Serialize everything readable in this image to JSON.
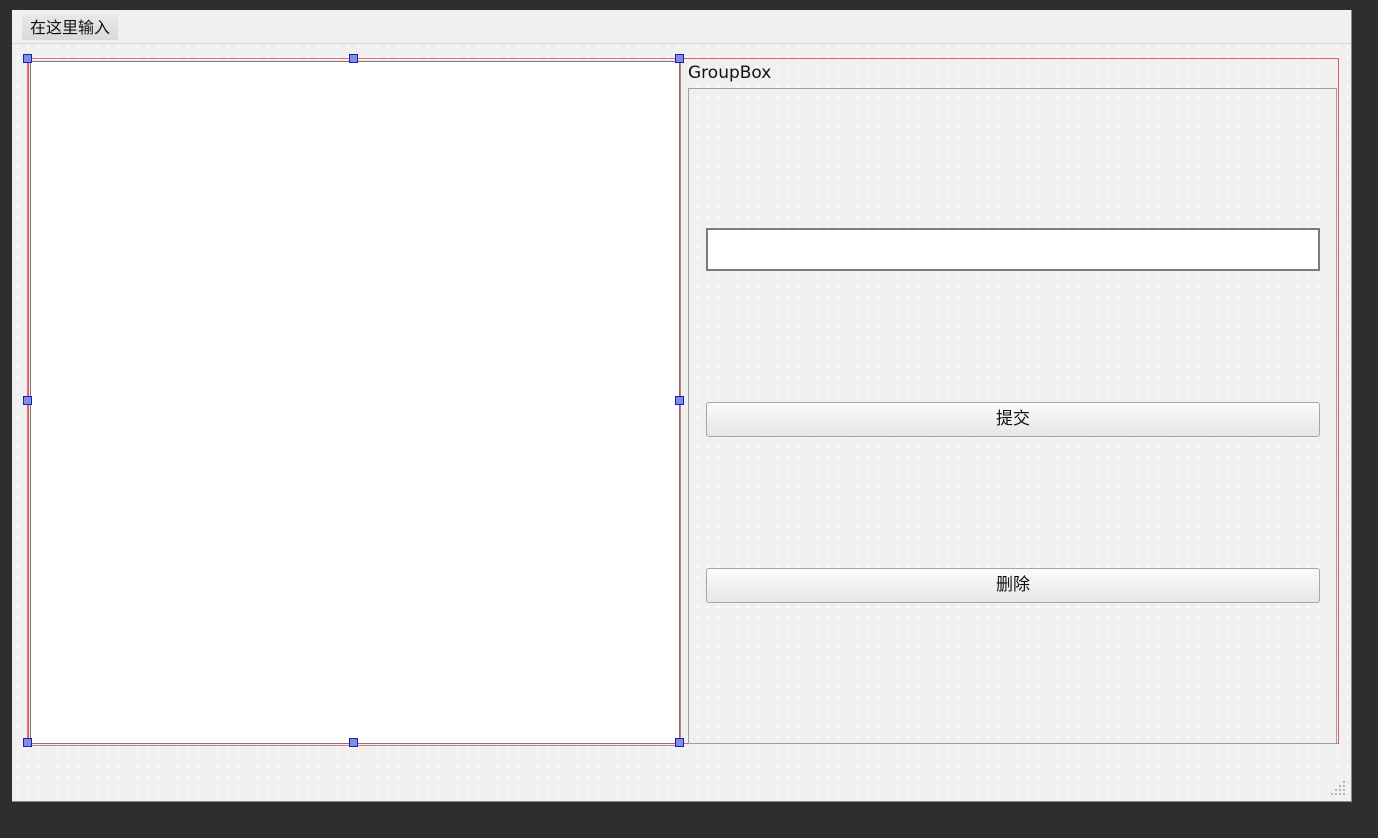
{
  "menubar": {
    "items": [
      "在这里输入"
    ]
  },
  "groupbox": {
    "title": "GroupBox"
  },
  "line_edit": {
    "value": ""
  },
  "buttons": {
    "submit": "提交",
    "delete": "删除"
  },
  "colors": {
    "form_background": "#f0f0f0",
    "outer_background": "#2d2e30",
    "layout_border": "#e06060",
    "handle_fill": "#7f8fd8",
    "handle_border": "#1a1acc"
  },
  "icons": [
    "size-grip-icon"
  ]
}
